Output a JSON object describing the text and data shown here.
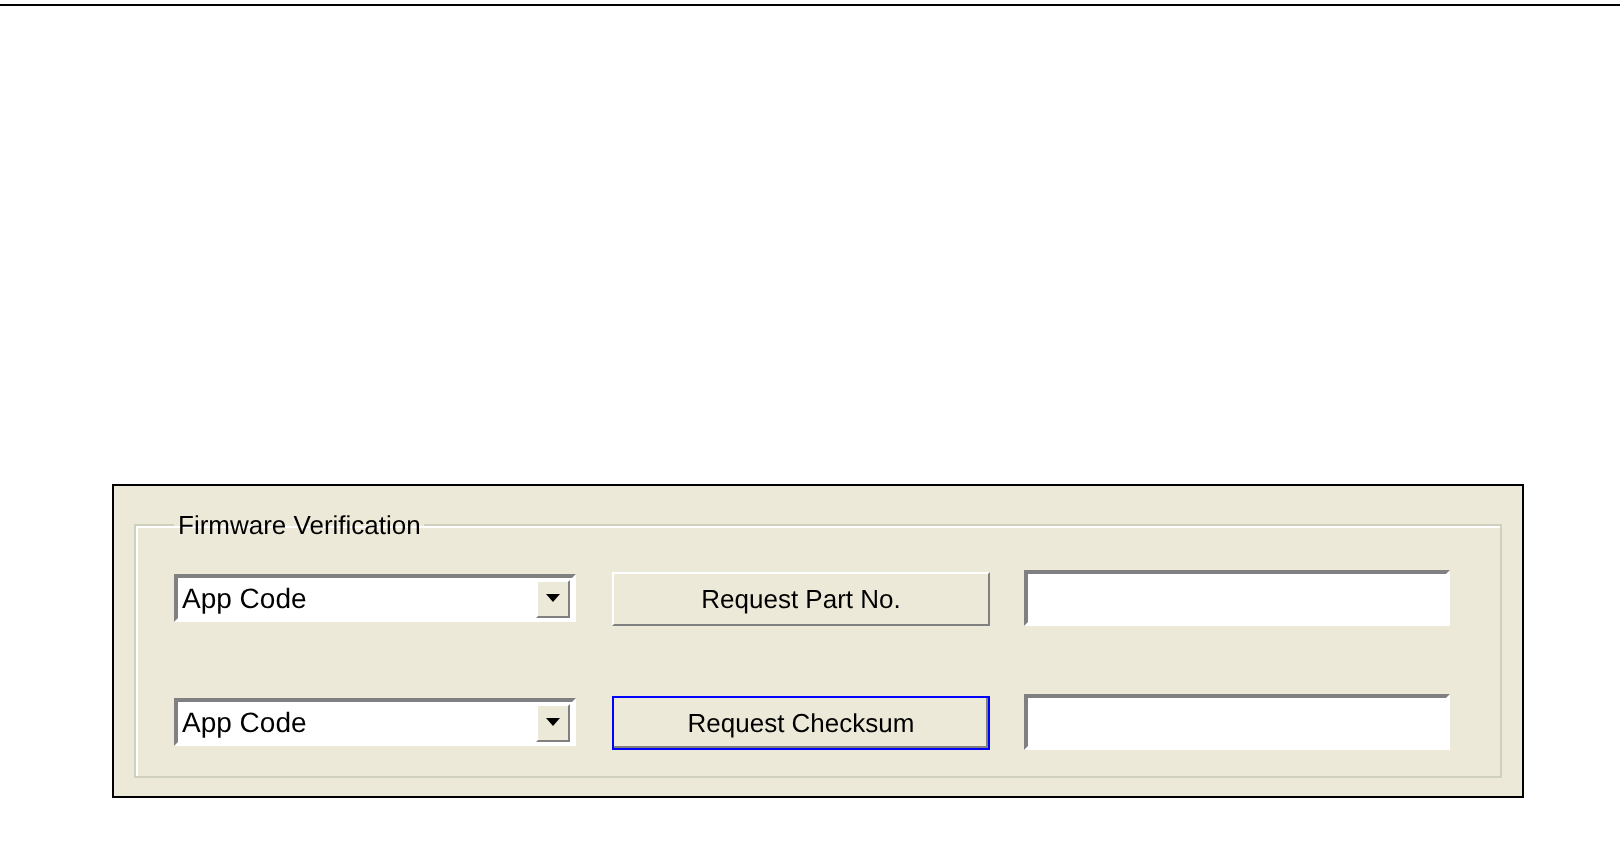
{
  "group": {
    "title": "Firmware Verification"
  },
  "rows": [
    {
      "combo": "App Code",
      "button": "Request Part No.",
      "focused": false
    },
    {
      "combo": "App Code",
      "button": "Request Checksum",
      "focused": true
    }
  ]
}
